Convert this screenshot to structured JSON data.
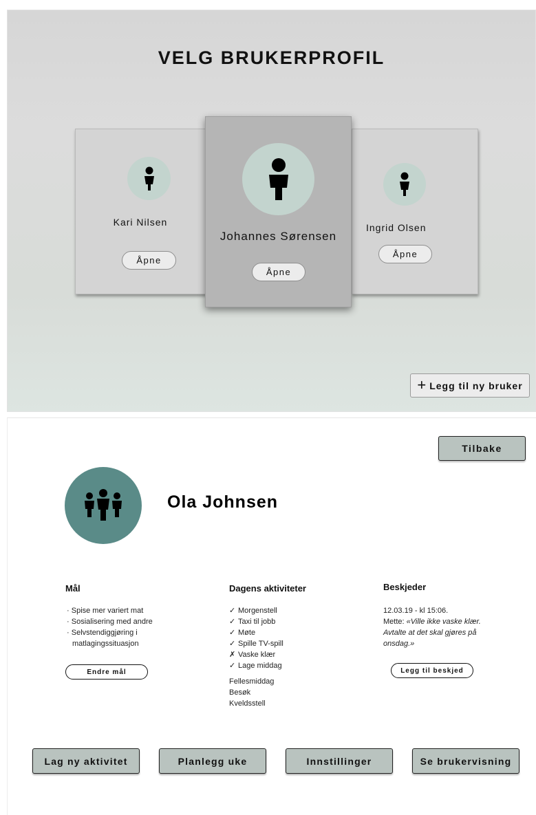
{
  "selection": {
    "title": "VELG BRUKERPROFIL",
    "profiles": [
      {
        "name": "Kari Nilsen",
        "open_label": "Åpne"
      },
      {
        "name": "Johannes Sørensen",
        "open_label": "Åpne"
      },
      {
        "name": "Ingrid Olsen",
        "open_label": "Åpne"
      }
    ],
    "add_user_label": "Legg til ny bruker",
    "add_icon": "+"
  },
  "overview": {
    "back_label": "Tilbake",
    "user_name": "Ola Johnsen",
    "goals": {
      "heading": "Mål",
      "items": [
        "Spise mer variert mat",
        "Sosialisering med andre",
        "Selvstendiggjøring i matlagingssituasjon"
      ],
      "edit_label": "Endre mål"
    },
    "activities": {
      "heading": "Dagens aktiviteter",
      "items": [
        {
          "mark": "✓",
          "label": "Morgenstell"
        },
        {
          "mark": "✓",
          "label": "Taxi til jobb"
        },
        {
          "mark": "✓",
          "label": "Møte"
        },
        {
          "mark": "✓",
          "label": "Spille TV-spill"
        },
        {
          "mark": "✗",
          "label": "Vaske klær"
        },
        {
          "mark": "✓",
          "label": "Lage middag"
        }
      ],
      "upcoming": [
        "Fellesmiddag",
        "Besøk",
        "Kveldsstell"
      ]
    },
    "messages": {
      "heading": "Beskjeder",
      "timestamp": "12.03.19 - kl 15:06.",
      "author": "Mette:",
      "text": "«Ville ikke vaske klær. Avtalte at det skal gjøres på onsdag.»",
      "add_label": "Legg til beskjed"
    },
    "actions": [
      "Lag ny aktivitet",
      "Planlegg uke",
      "Innstillinger",
      "Se brukervisning"
    ]
  },
  "colors": {
    "avatar_light": "#c3d4ce",
    "avatar_dark": "#5a8b88",
    "button_fill": "#b9c3bf"
  }
}
